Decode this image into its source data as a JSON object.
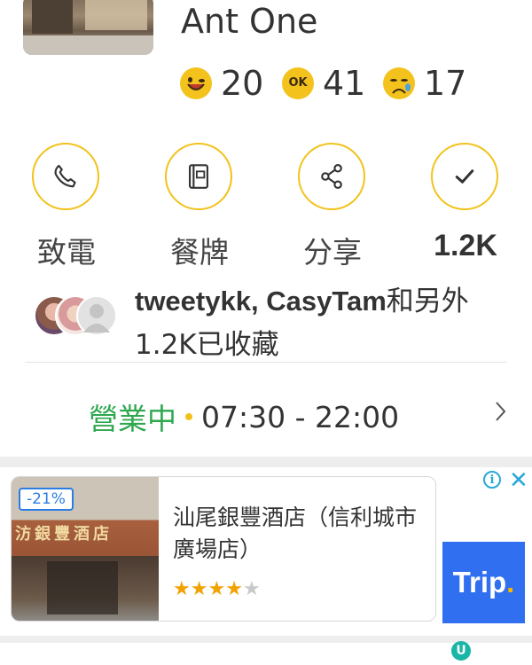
{
  "restaurant": {
    "name": "Ant One",
    "ratings": [
      {
        "icon": "smile-emoji-icon",
        "count": "20"
      },
      {
        "icon": "ok-emoji-icon",
        "icon_text": "OK",
        "count": "41"
      },
      {
        "icon": "sad-emoji-icon",
        "count": "17"
      }
    ]
  },
  "actions": [
    {
      "icon": "phone-icon",
      "label": "致電"
    },
    {
      "icon": "menu-icon",
      "label": "餐牌"
    },
    {
      "icon": "share-icon",
      "label": "分享"
    },
    {
      "icon": "check-icon",
      "label": "1.2K"
    }
  ],
  "favorites": {
    "names": "tweetykk",
    "names2": "CasyTam",
    "text": "和另外1.2K已收藏"
  },
  "hours": {
    "status": "營業中",
    "time": "07:30 - 22:00"
  },
  "ad": {
    "discount": "-21%",
    "sign_text": "汸銀豐酒店",
    "title": "汕尾銀豐酒店（信利城市廣場店）",
    "stars_filled": 4,
    "stars_total": 5,
    "brand": "Trip",
    "brand_dot": ".",
    "info_icon": "info-icon",
    "close_icon": "close-icon"
  },
  "colors": {
    "accent": "#f2c21b",
    "open_green": "#2fa84f",
    "trip_blue": "#2f6ff0"
  }
}
